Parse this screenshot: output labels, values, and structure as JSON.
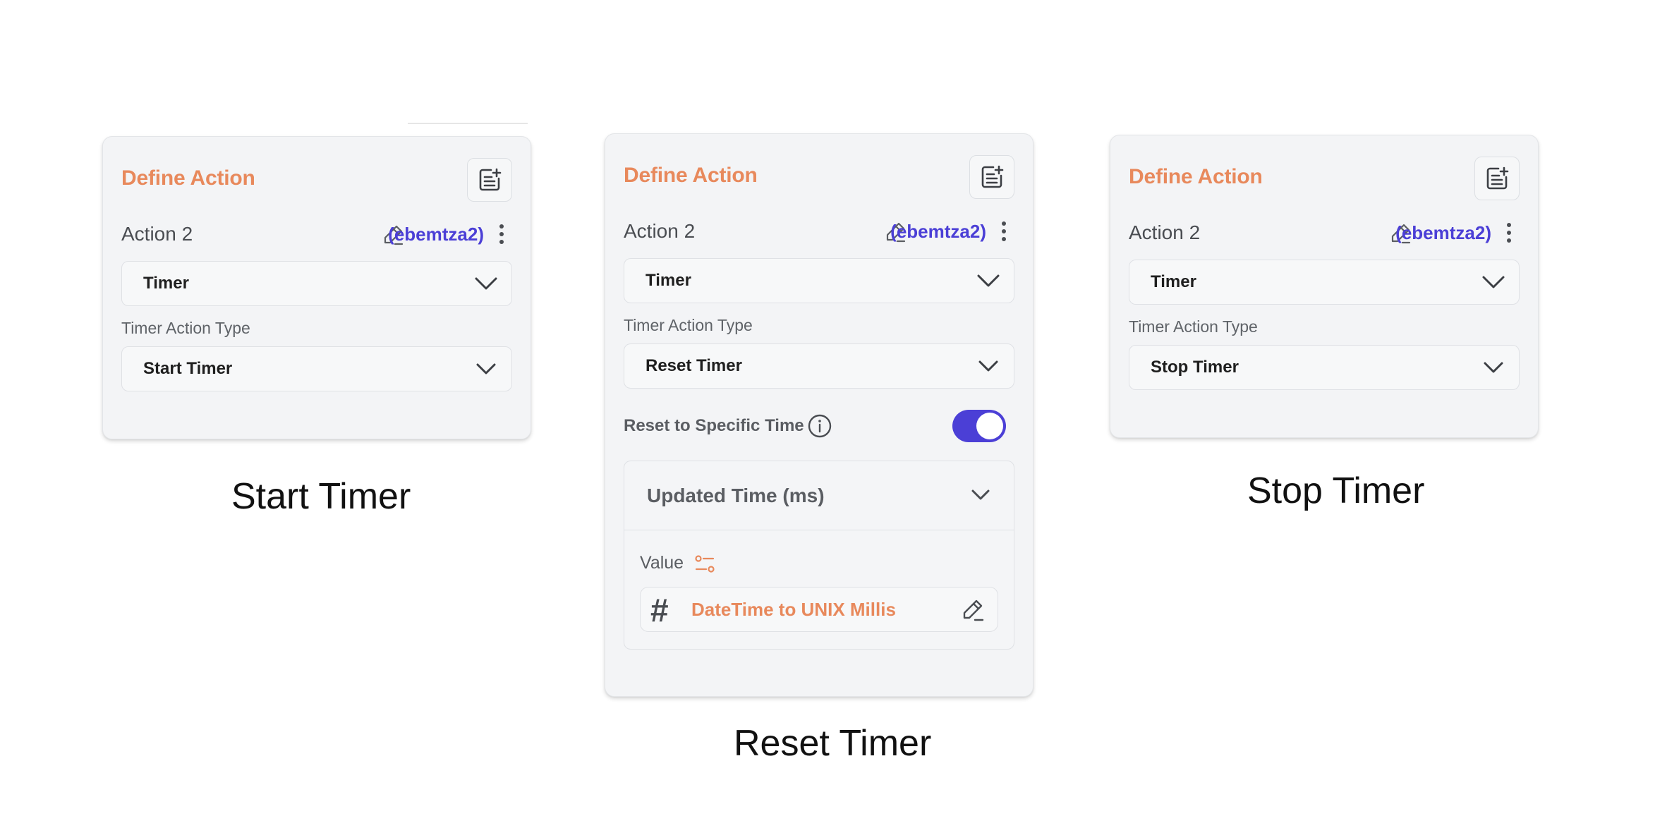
{
  "cards": {
    "start": {
      "title": "Define Action",
      "action_name": "Action 2",
      "action_id": "(ebemtza2)",
      "action_select": "Timer",
      "type_label": "Timer Action Type",
      "type_select": "Start Timer"
    },
    "reset": {
      "title": "Define Action",
      "action_name": "Action 2",
      "action_id": "(ebemtza2)",
      "action_select": "Timer",
      "type_label": "Timer Action Type",
      "type_select": "Reset Timer",
      "toggle_label": "Reset to Specific Time",
      "toggle_on": true,
      "time_title": "Updated Time (ms)",
      "value_label": "Value",
      "value_text": "DateTime to UNIX Millis"
    },
    "stop": {
      "title": "Define Action",
      "action_name": "Action 2",
      "action_id": "(ebemtza2)",
      "action_select": "Timer",
      "type_label": "Timer Action Type",
      "type_select": "Stop Timer"
    }
  },
  "captions": {
    "start": "Start Timer",
    "reset": "Reset Timer",
    "stop": "Stop Timer"
  },
  "icons": {
    "note": "note-add-icon",
    "edit": "pencil-icon",
    "more": "more-vertical-icon",
    "chevron": "chevron-down-icon",
    "info": "info-icon",
    "slider": "tune-icon",
    "hash": "hash-icon"
  },
  "colors": {
    "accent_orange": "#e8895c",
    "accent_purple": "#4b3fd6",
    "card_bg": "#f3f4f6"
  }
}
